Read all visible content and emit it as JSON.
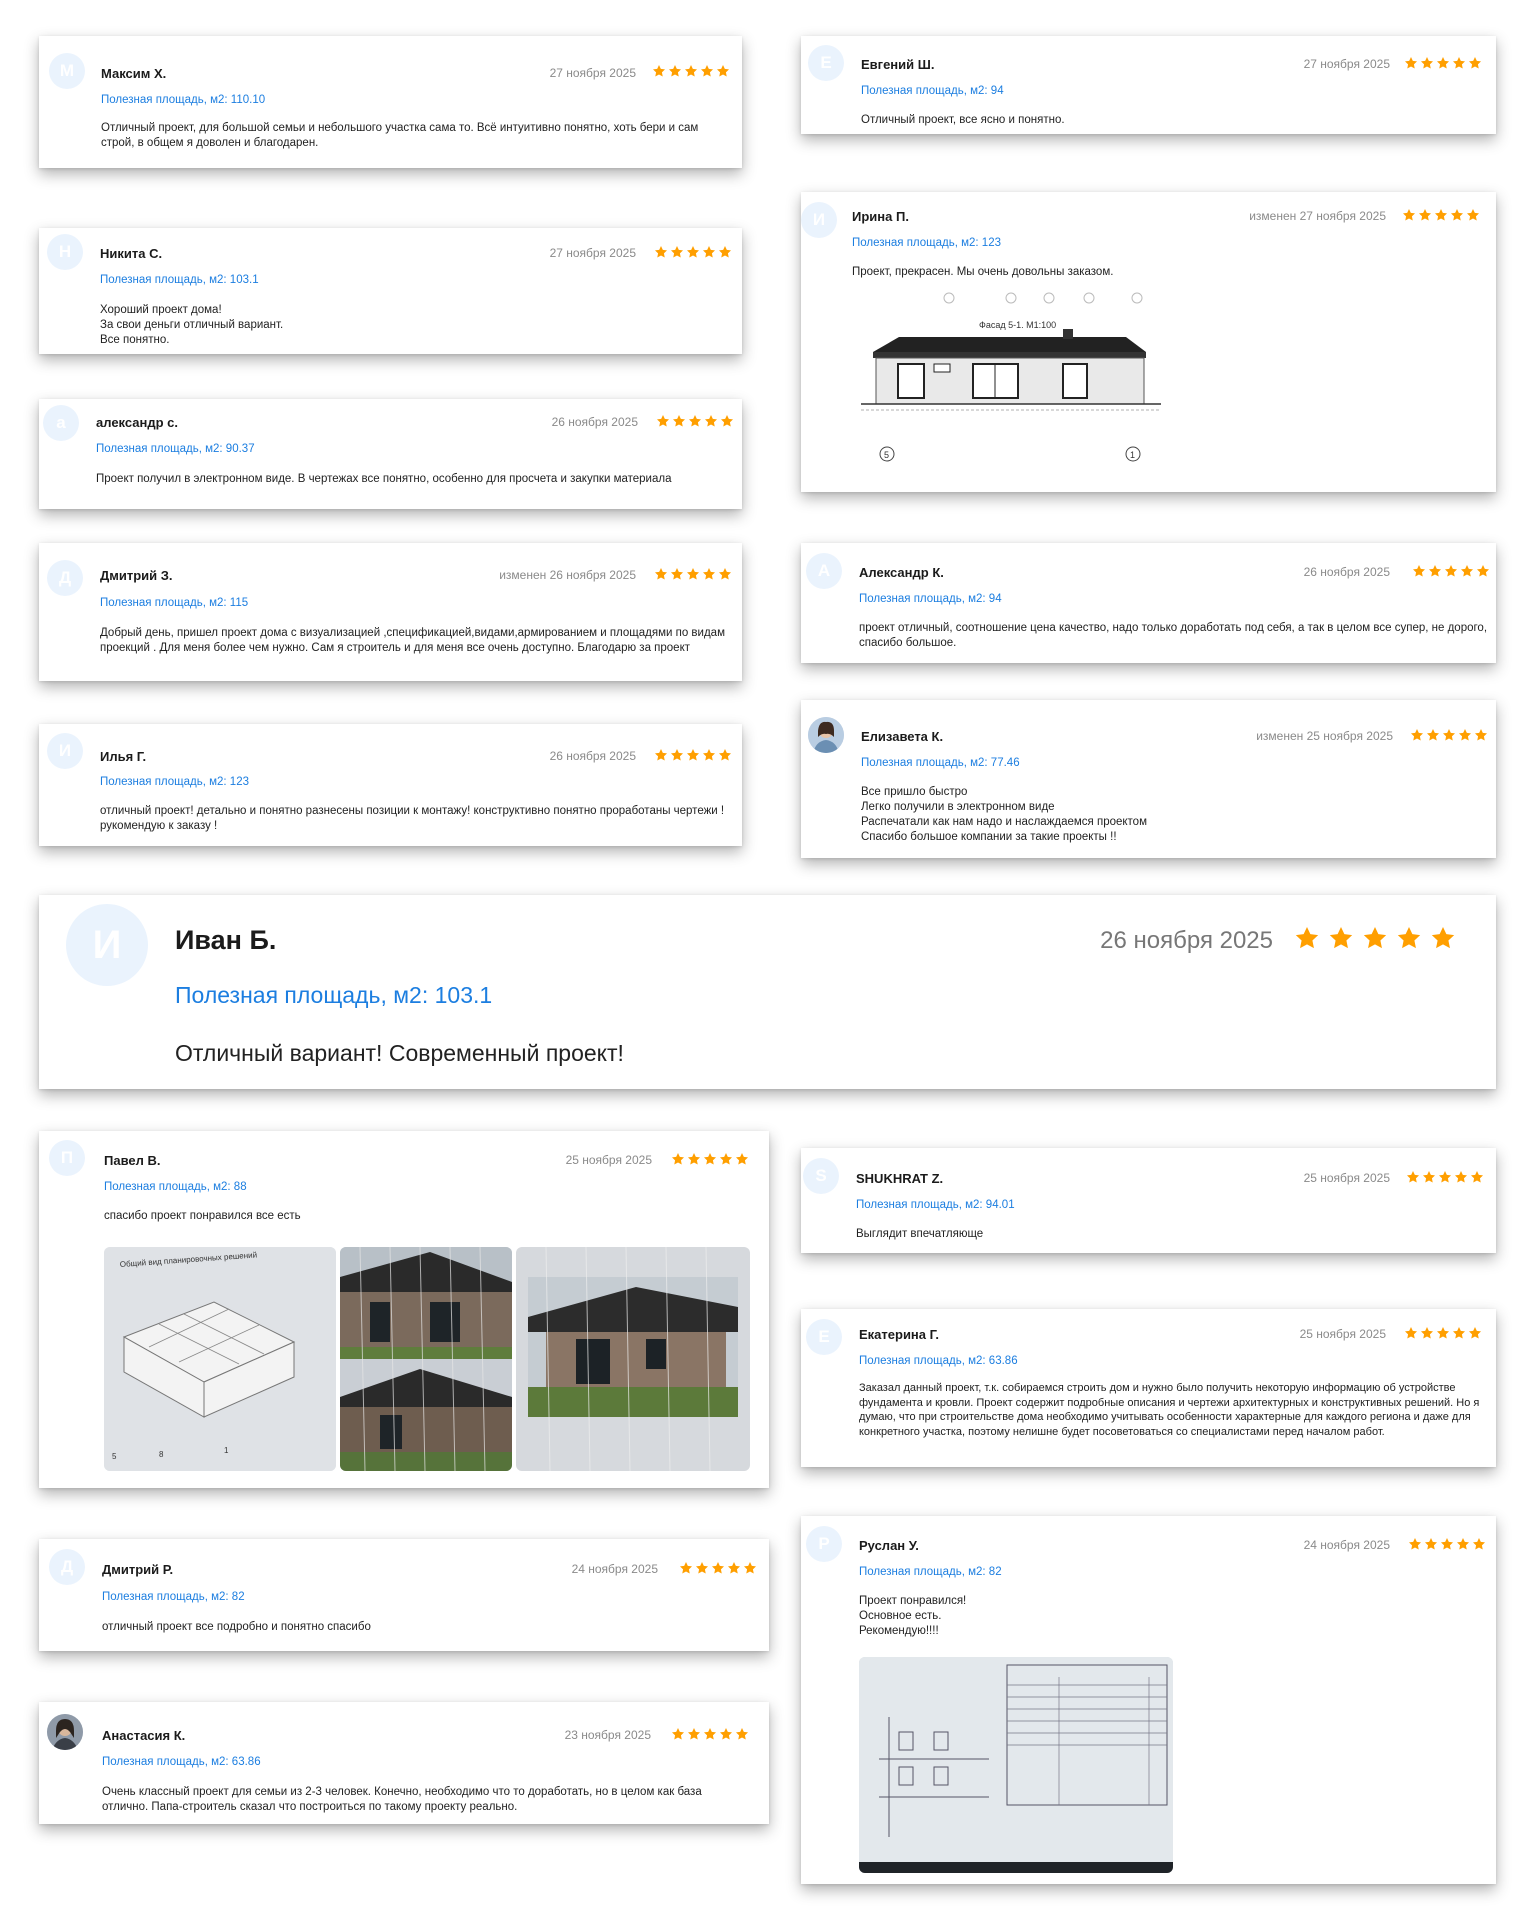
{
  "colors": {
    "accent": "#1c7ee0",
    "star": "#ff9f00",
    "avatar_bg": "#eaf3fd",
    "date": "#8a8a8a"
  },
  "reviews": [
    {
      "avatar_letter": "М",
      "name": "Максим Х.",
      "date": "27 ноября 2025",
      "rating": 5,
      "area": "Полезная площадь, м2: 110.10",
      "text": "Отличный проект, для большой семьи и небольшого участка сама то. Всё интуитивно понятно, хоть бери и сам строй, в общем я доволен и благодарен."
    },
    {
      "avatar_letter": "Е",
      "name": "Евгений Ш.",
      "date": "27 ноября 2025",
      "rating": 5,
      "area": "Полезная площадь, м2: 94",
      "text": "Отличный проект, все ясно и понятно."
    },
    {
      "avatar_letter": "Н",
      "name": "Никита С.",
      "date": "27 ноября 2025",
      "rating": 5,
      "area": "Полезная площадь, м2: 103.1",
      "text": "Хороший проект дома!\nЗа свои деньги отличный вариант.\nВсе понятно."
    },
    {
      "avatar_letter": "И",
      "name": "Ирина П.",
      "date": "изменен 27 ноября 2025",
      "rating": 5,
      "area": "Полезная площадь, м2: 123",
      "text": "Проект, прекрасен. Мы очень довольны заказом.",
      "image_caption": "Фасад 5-1. М1:100"
    },
    {
      "avatar_letter": "а",
      "name": "александр с.",
      "date": "26 ноября 2025",
      "rating": 5,
      "area": "Полезная площадь, м2: 90.37",
      "text": "Проект получил в электронном виде. В чертежах все понятно, особенно для просчета и закупки материала"
    },
    {
      "avatar_letter": "Д",
      "name": "Дмитрий З.",
      "date": "изменен 26 ноября 2025",
      "rating": 5,
      "area": "Полезная площадь, м2: 115",
      "text": "Добрый день, пришел проект дома с визуализацией ,спецификацией,видами,армированием и площадями по видам проекций . Для меня более чем нужно. Сам я строитель и для меня все очень доступно. Благодарю за проект"
    },
    {
      "avatar_letter": "А",
      "name": "Александр К.",
      "date": "26 ноября 2025",
      "rating": 5,
      "area": "Полезная площадь, м2: 94",
      "text": "проект отличный, соотношение цена качество, надо только доработать под себя, а так в целом все супер, не дорого, спасибо большое."
    },
    {
      "avatar_letter": "И",
      "name": "Илья Г.",
      "date": "26 ноября 2025",
      "rating": 5,
      "area": "Полезная площадь, м2: 123",
      "text": "отличный проект! детально и понятно разнесены позиции к монтажу! конструктивно понятно проработаны чертежи ! рукомендую к заказу !"
    },
    {
      "avatar_letter": "",
      "name": "Елизавета К.",
      "date": "изменен 25 ноября 2025",
      "rating": 5,
      "area": "Полезная площадь, м2: 77.46",
      "text": "Все пришло быстро\nЛегко получили в электронном виде\nРаспечатали как нам надо и наслаждаемся проектом\nСпасибо большое компании за такие проекты !!"
    },
    {
      "avatar_letter": "И",
      "name": "Иван Б.",
      "date": "26 ноября 2025",
      "rating": 5,
      "area": "Полезная площадь, м2: 103.1",
      "text": "Отличный вариант! Современный проект!"
    },
    {
      "avatar_letter": "П",
      "name": "Павел В.",
      "date": "25 ноября 2025",
      "rating": 5,
      "area": "Полезная площадь, м2: 88",
      "text": "спасибо проект понравился все есть",
      "image_caption": "Общий вид планировочных решений"
    },
    {
      "avatar_letter": "S",
      "name": "SHUKHRAT Z.",
      "date": "25 ноября 2025",
      "rating": 5,
      "area": "Полезная площадь, м2: 94.01",
      "text": "Выглядит впечатляюще"
    },
    {
      "avatar_letter": "Е",
      "name": "Екатерина Г.",
      "date": "25 ноября 2025",
      "rating": 5,
      "area": "Полезная площадь, м2: 63.86",
      "text": "Заказал данный проект, т.к. собираемся строить дом и нужно было получить некоторую информацию об устройстве фундамента и кровли. Проект содержит подробные описания и чертежи архитектурных и конструктивных решений. Но я думаю, что при строительстве дома необходимо учитывать особенности характерные для каждого региона и даже для конкретного участка, поэтому нелишне будет посоветоваться со специалистами перед началом работ."
    },
    {
      "avatar_letter": "Д",
      "name": "Дмитрий Р.",
      "date": "24 ноября 2025",
      "rating": 5,
      "area": "Полезная площадь, м2: 82",
      "text": "отличный проект все подробно и понятно спасибо"
    },
    {
      "avatar_letter": "Р",
      "name": "Руслан У.",
      "date": "24 ноября 2025",
      "rating": 5,
      "area": "Полезная площадь, м2: 82",
      "text": "Проект понравился!\nОсновное есть.\nРекомендую!!!!"
    },
    {
      "avatar_letter": "",
      "name": "Анастасия К.",
      "date": "23 ноября 2025",
      "rating": 5,
      "area": "Полезная площадь, м2: 63.86",
      "text": "Очень классный проект для семьи из 2-3 человек. Конечно, необходимо что то доработать, но в целом как база отлично. Папа-строитель сказал что построиться по такому проекту реально."
    }
  ]
}
